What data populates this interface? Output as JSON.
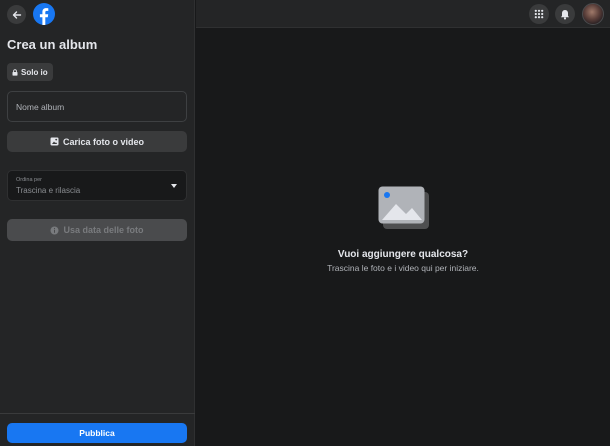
{
  "sidebar": {
    "title": "Crea un album",
    "privacy_label": "Solo io",
    "album_name_placeholder": "Nome album",
    "upload_label": "Carica foto o video",
    "sort": {
      "label": "Ordina per",
      "value": "Trascina e rilascia"
    },
    "use_date_label": "Usa data delle foto",
    "publish_label": "Pubblica"
  },
  "main": {
    "empty_title": "Vuoi aggiungere qualcosa?",
    "empty_subtitle": "Trascina le foto e i video qui per iniziare."
  },
  "icons": {
    "back": "arrow-left-icon",
    "logo": "facebook-logo-icon",
    "privacy": "lock-icon",
    "upload": "photo-add-icon",
    "use_date": "info-icon",
    "menu": "grid-menu-icon",
    "notifications": "bell-icon",
    "empty": "image-placeholder-icon"
  },
  "colors": {
    "background": "#18191a",
    "surface": "#242526",
    "button": "#3a3b3c",
    "accent": "#1877f2",
    "text_primary": "#e4e6eb",
    "text_secondary": "#b0b3b8"
  }
}
